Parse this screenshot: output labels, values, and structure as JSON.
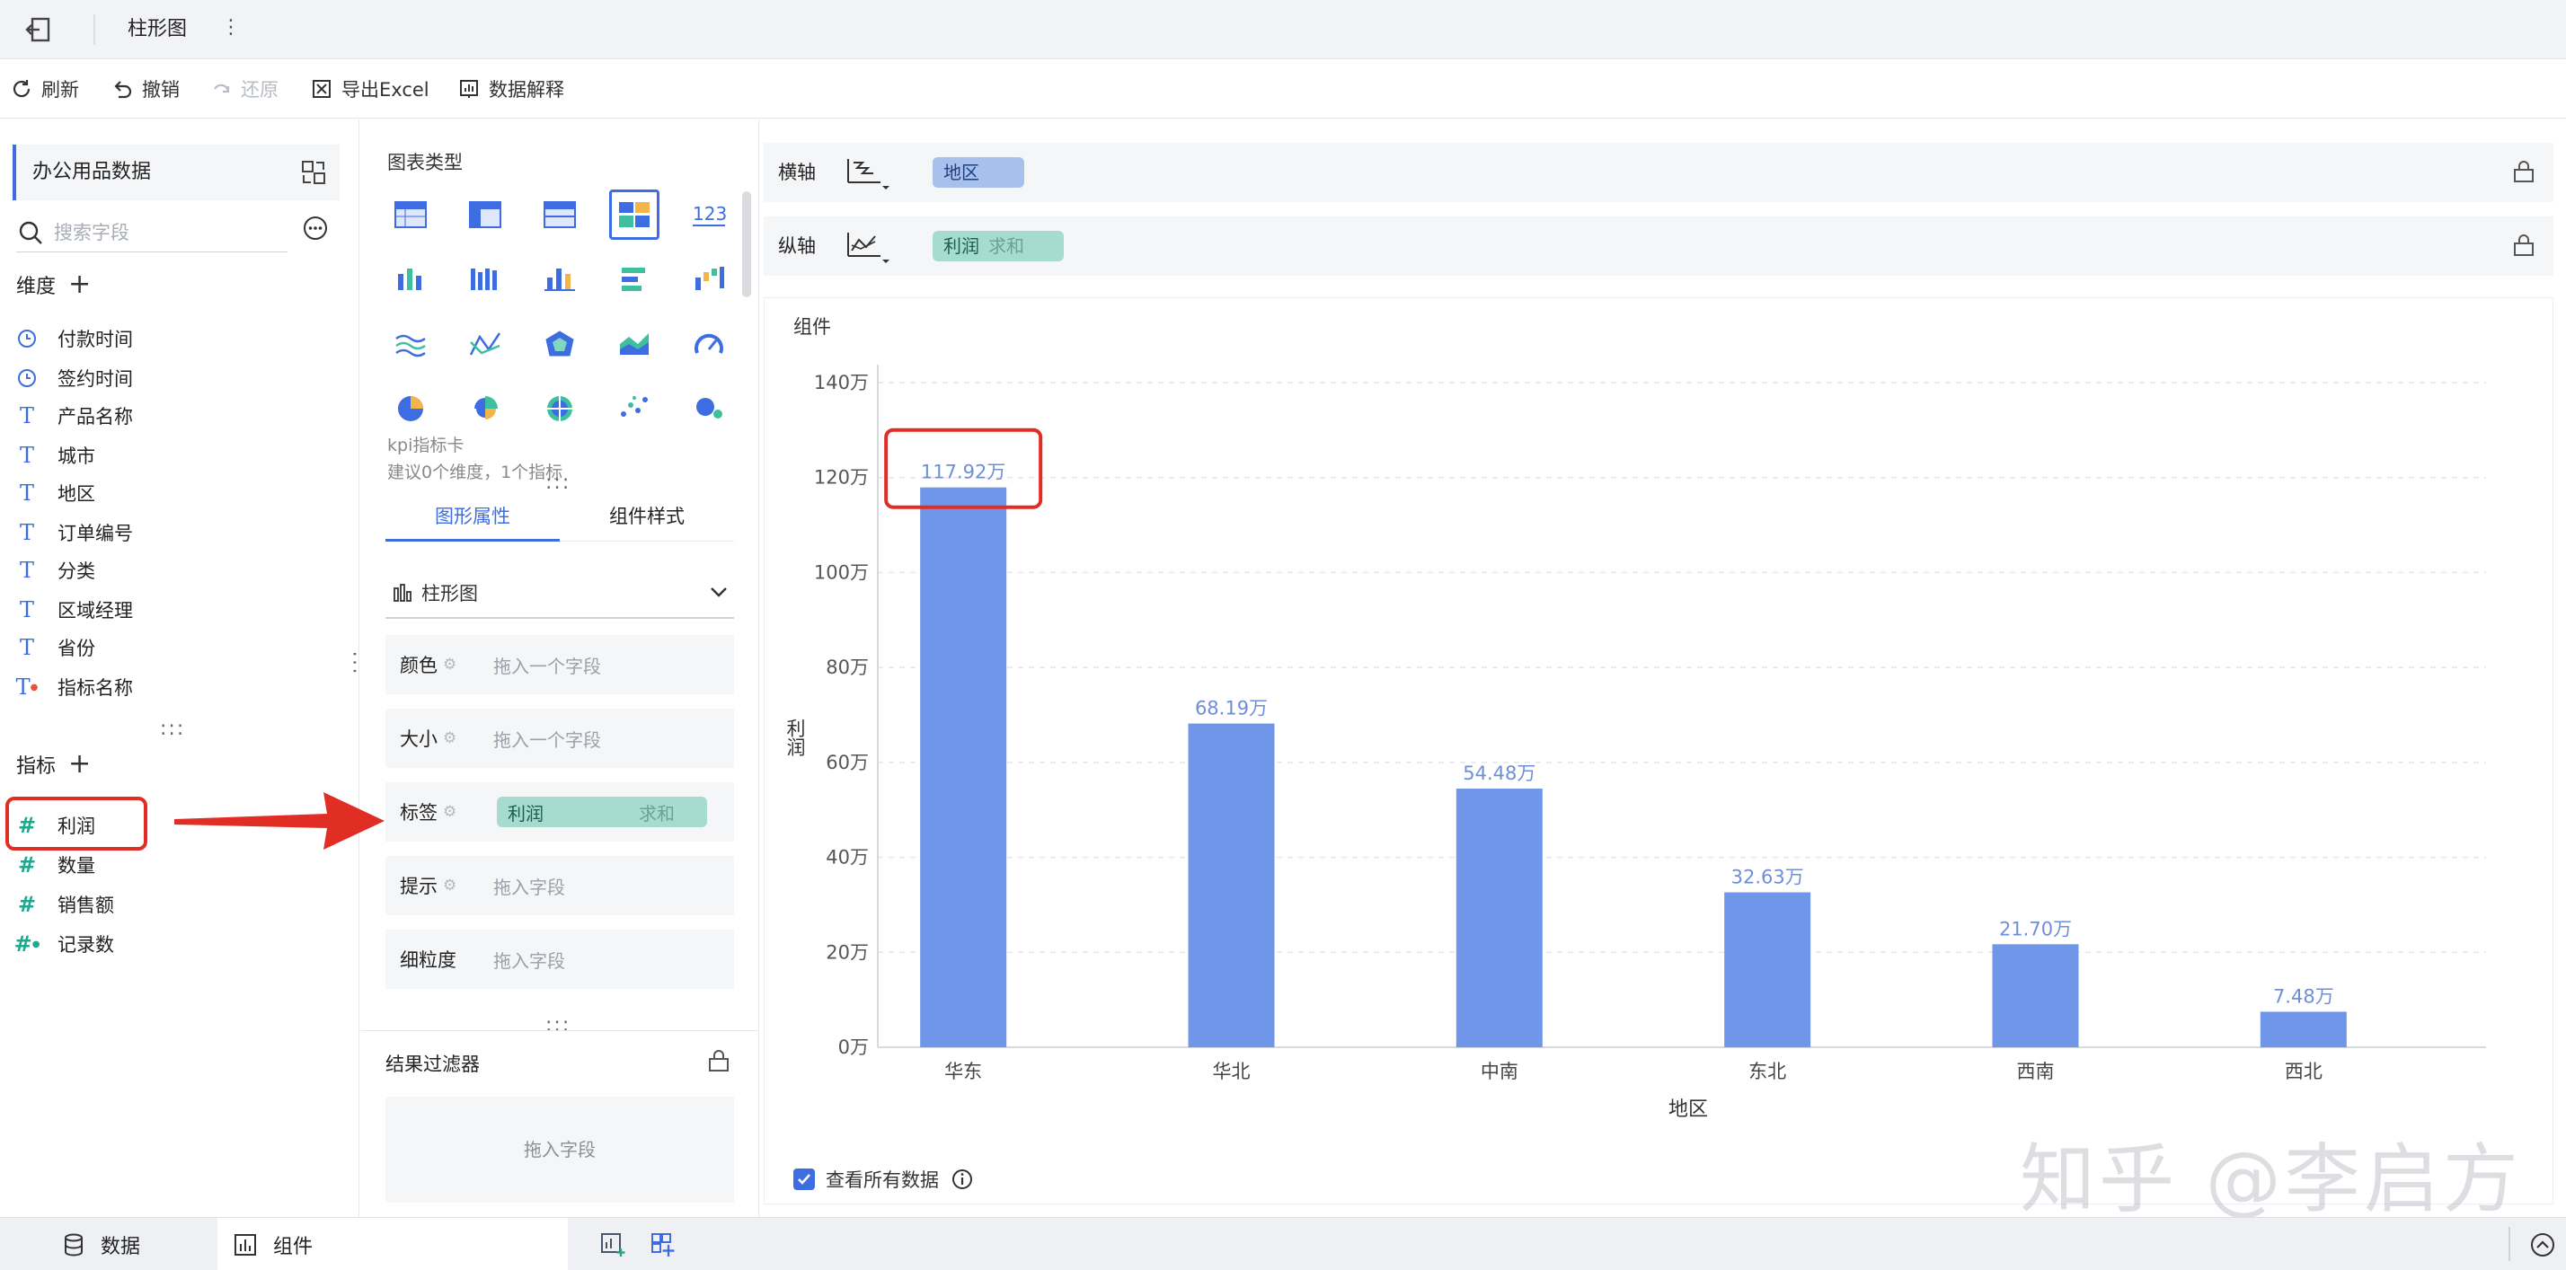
{
  "topbar": {
    "title": "柱形图",
    "more": "⋮"
  },
  "toolbar": {
    "refresh": "刷新",
    "undo": "撤销",
    "redo": "还原",
    "export": "导出Excel",
    "explain": "数据解释"
  },
  "dataset": {
    "name": "办公用品数据"
  },
  "search": {
    "placeholder": "搜索字段"
  },
  "dimensions": {
    "title": "维度",
    "items": [
      "付款时间",
      "签约时间",
      "产品名称",
      "城市",
      "地区",
      "订单编号",
      "分类",
      "区域经理",
      "省份",
      "指标名称"
    ]
  },
  "measures": {
    "title": "指标",
    "items": [
      "利润",
      "数量",
      "销售额",
      "记录数"
    ]
  },
  "chart_types": {
    "label": "图表类型",
    "selected_name": "kpi指标卡",
    "selected_hint": "建议0个维度，1个指标"
  },
  "tabs": {
    "props": "图形属性",
    "style": "组件样式"
  },
  "chart_type_select": {
    "value": "柱形图"
  },
  "props": {
    "color": {
      "label": "颜色",
      "placeholder": "拖入一个字段"
    },
    "size": {
      "label": "大小",
      "placeholder": "拖入一个字段"
    },
    "label": {
      "label": "标签",
      "field": "利润",
      "agg": "求和"
    },
    "tooltip": {
      "label": "提示",
      "placeholder": "拖入字段"
    },
    "granularity": {
      "label": "细粒度",
      "placeholder": "拖入字段"
    }
  },
  "result_filter": {
    "title": "结果过滤器",
    "placeholder": "拖入字段"
  },
  "axes": {
    "x": {
      "label": "横轴",
      "field": "地区"
    },
    "y": {
      "label": "纵轴",
      "field": "利润",
      "agg": "求和"
    }
  },
  "chart": {
    "card_title": "组件",
    "show_all_label": "查看所有数据"
  },
  "chart_data": {
    "type": "bar",
    "categories": [
      "华东",
      "华北",
      "中南",
      "东北",
      "西南",
      "西北"
    ],
    "values": [
      117.92,
      68.19,
      54.48,
      32.63,
      21.7,
      7.48
    ],
    "data_labels": [
      "117.92万",
      "68.19万",
      "54.48万",
      "32.63万",
      "21.70万",
      "7.48万"
    ],
    "yticks": [
      "0万",
      "20万",
      "40万",
      "60万",
      "80万",
      "100万",
      "120万",
      "140万"
    ],
    "ylim": [
      0,
      140
    ],
    "xlabel": "地区",
    "ylabel": "利润",
    "grid": true,
    "bar_color": "#7096ea"
  },
  "watermark": "知乎 @李启方",
  "bottom": {
    "data_tab": "数据",
    "component_tab": "组件"
  },
  "colors": {
    "accent": "#3d6de0",
    "highlight": "#e02e24",
    "bar": "#7096ea"
  }
}
